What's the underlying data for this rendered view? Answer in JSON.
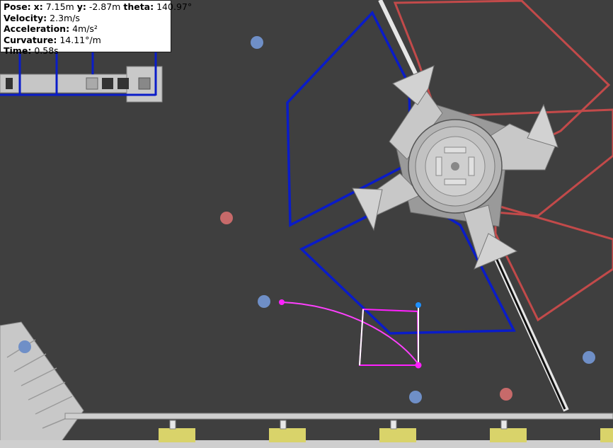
{
  "telemetry": {
    "pose_label": "Pose:",
    "x_label": "x:",
    "x_value": "7.15m",
    "y_label": "y:",
    "y_value": "-2.87m",
    "theta_label": "theta:",
    "theta_value": "140.97°",
    "velocity_label": "Velocity:",
    "velocity_value": "2.3m/s",
    "acceleration_label": "Acceleration:",
    "acceleration_value": "4m/s²",
    "curvature_label": "Curvature:",
    "curvature_value": "14.11°/m",
    "time_label": "Time:",
    "time_value": "0.58s"
  },
  "colors": {
    "field": "#3f3f3f",
    "blue_zone": "#0a1cc8",
    "red_zone": "#c24a4a",
    "path": "#ff40ff",
    "ball_blue": "#6f8fc7",
    "ball_red": "#c76a6a",
    "hub_gray": "#c8c8c8",
    "bumper_yellow": "#d9d36a"
  }
}
